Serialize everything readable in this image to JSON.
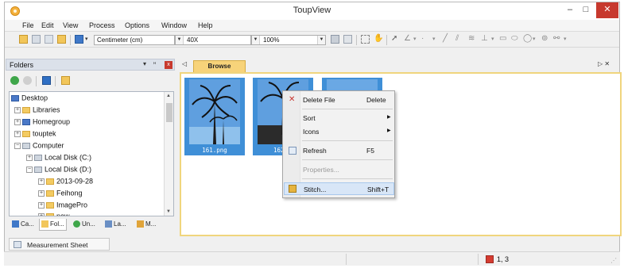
{
  "window": {
    "title": "ToupView",
    "min_label": "–",
    "max_label": "□",
    "close_label": "✕"
  },
  "menu": [
    "File",
    "Edit",
    "View",
    "Process",
    "Options",
    "Window",
    "Help"
  ],
  "toolbar": {
    "unit": "Centimeter (cm)",
    "magnification": "40X",
    "zoom": "100%"
  },
  "folders_panel": {
    "title": "Folders",
    "pin_label": "▾ ᵸ",
    "close_label": "x",
    "tree": [
      {
        "label": "Desktop",
        "level": 0,
        "icon": "desktop-icon",
        "expander": ""
      },
      {
        "label": "Libraries",
        "level": 1,
        "icon": "libraries-icon",
        "expander": "+"
      },
      {
        "label": "Homegroup",
        "level": 1,
        "icon": "homegroup-icon",
        "expander": "+"
      },
      {
        "label": "touptek",
        "level": 1,
        "icon": "user-folder-icon",
        "expander": "+"
      },
      {
        "label": "Computer",
        "level": 1,
        "icon": "computer-icon",
        "expander": "−"
      },
      {
        "label": "Local Disk (C:)",
        "level": 2,
        "icon": "drive-icon",
        "expander": "+"
      },
      {
        "label": "Local Disk (D:)",
        "level": 2,
        "icon": "drive-icon",
        "expander": "−"
      },
      {
        "label": "2013-09-28",
        "level": 3,
        "icon": "folder-icon",
        "expander": "+"
      },
      {
        "label": "Feihong",
        "level": 3,
        "icon": "folder-icon",
        "expander": "+"
      },
      {
        "label": "ImagePro",
        "level": 3,
        "icon": "folder-icon",
        "expander": "+"
      },
      {
        "label": "new",
        "level": 3,
        "icon": "folder-icon",
        "expander": "+"
      }
    ],
    "tabs": [
      "Ca...",
      "Fol...",
      "Un...",
      "La...",
      "M..."
    ],
    "active_tab": 1
  },
  "document": {
    "tab_label": "Browse",
    "left_arrow": "◁",
    "right_arrows": "▷ ✕",
    "thumbnails": [
      {
        "label": "161.png"
      },
      {
        "label": "162"
      },
      {
        "label": ""
      }
    ]
  },
  "context_menu": {
    "items": [
      {
        "label": "Delete File",
        "shortcut": "Delete",
        "icon": "delete-icon",
        "submenu": false,
        "disabled": false,
        "highlighted": false
      },
      {
        "label": "Sort",
        "shortcut": "",
        "icon": "",
        "submenu": true,
        "disabled": false,
        "highlighted": false
      },
      {
        "label": "Icons",
        "shortcut": "",
        "icon": "",
        "submenu": true,
        "disabled": false,
        "highlighted": false
      },
      {
        "label": "Refresh",
        "shortcut": "F5",
        "icon": "refresh-icon",
        "submenu": false,
        "disabled": false,
        "highlighted": false
      },
      {
        "label": "Properties...",
        "shortcut": "",
        "icon": "",
        "submenu": false,
        "disabled": true,
        "highlighted": false
      },
      {
        "label": "Stitch...",
        "shortcut": "Shift+T",
        "icon": "stitch-icon",
        "submenu": false,
        "disabled": false,
        "highlighted": true
      }
    ]
  },
  "bottom_tab": {
    "label": "Measurement Sheet"
  },
  "status": {
    "position": "1, 3"
  },
  "colors": {
    "thumb_selected": "#3f8fd7",
    "doc_tab": "#f7d37a",
    "close_red": "#c7392e"
  }
}
